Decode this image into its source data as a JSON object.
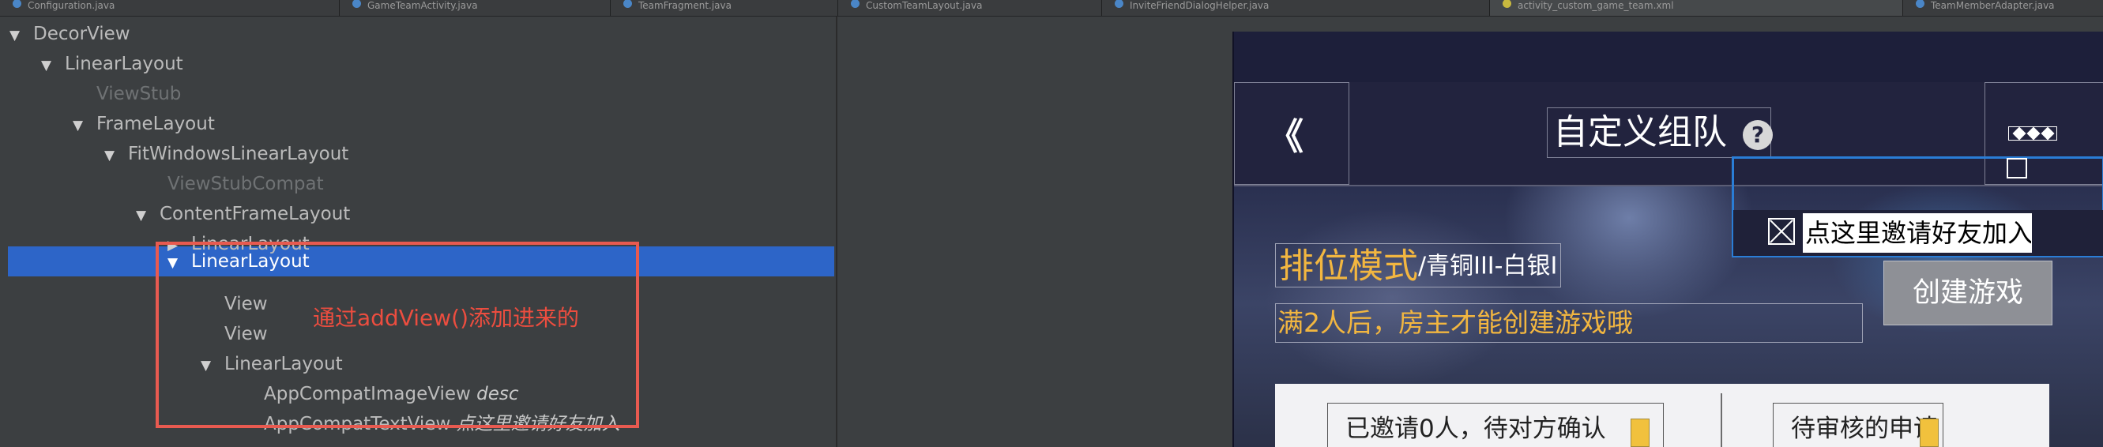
{
  "tabs": [
    {
      "label": "Configuration.java",
      "active": false
    },
    {
      "label": "GameTeamActivity.java",
      "active": false
    },
    {
      "label": "TeamFragment.java",
      "active": false
    },
    {
      "label": "CustomTeamLayout.java",
      "active": false
    },
    {
      "label": "InviteFriendDialogHelper.java",
      "active": false
    },
    {
      "label": "activity_custom_game_team.xml",
      "active": true
    },
    {
      "label": "TeamMemberAdapter.java",
      "active": false
    }
  ],
  "tree": {
    "nodes": [
      {
        "label": "DecorView",
        "desc": "",
        "arrow": "▼",
        "dim": false,
        "selected": false
      },
      {
        "label": "LinearLayout",
        "desc": "",
        "arrow": "▼",
        "dim": false,
        "selected": false
      },
      {
        "label": "ViewStub",
        "desc": "",
        "arrow": "",
        "dim": true,
        "selected": false
      },
      {
        "label": "FrameLayout",
        "desc": "",
        "arrow": "▼",
        "dim": false,
        "selected": false
      },
      {
        "label": "FitWindowsLinearLayout",
        "desc": "",
        "arrow": "▼",
        "dim": false,
        "selected": false
      },
      {
        "label": "ViewStubCompat",
        "desc": "",
        "arrow": "",
        "dim": true,
        "selected": false
      },
      {
        "label": "ContentFrameLayout",
        "desc": "",
        "arrow": "▼",
        "dim": false,
        "selected": false
      },
      {
        "label": "LinearLayout",
        "desc": "",
        "arrow": "▶",
        "dim": false,
        "selected": false
      },
      {
        "label": "LinearLayout",
        "desc": "",
        "arrow": "▼",
        "dim": false,
        "selected": true
      },
      {
        "label": "View",
        "desc": "",
        "arrow": "",
        "dim": false,
        "selected": false
      },
      {
        "label": "View",
        "desc": "",
        "arrow": "",
        "dim": false,
        "selected": false
      },
      {
        "label": "LinearLayout",
        "desc": "",
        "arrow": "▼",
        "dim": false,
        "selected": false
      },
      {
        "label": "AppCompatImageView",
        "desc": "desc",
        "arrow": "",
        "dim": false,
        "selected": false
      },
      {
        "label": "AppCompatTextView",
        "desc": "点这里邀请好友加入",
        "arrow": "",
        "dim": false,
        "selected": false
      }
    ],
    "annotation": "通过addView()添加进来的"
  },
  "preview": {
    "title": "自定义组队",
    "help_glyph": "?",
    "back_glyph": "《",
    "mode_title": "排位模式",
    "mode_rank": "/青铜III-白银I",
    "hint": "满2人后，房主才能创建游戏哦",
    "create_button": "创建游戏",
    "invite_text": "点这里邀请好友加入",
    "status_invited": "已邀请0人，待对方确认",
    "status_pending": "待审核的申请",
    "colors": {
      "accent": "#f2b640",
      "selection": "#2d65c8",
      "highlight_box": "#2a7dd6",
      "annotation": "#ec4d3f"
    },
    "icons": [
      "back-icon",
      "help-icon",
      "more-icon",
      "close-icon",
      "edit-icon"
    ]
  }
}
